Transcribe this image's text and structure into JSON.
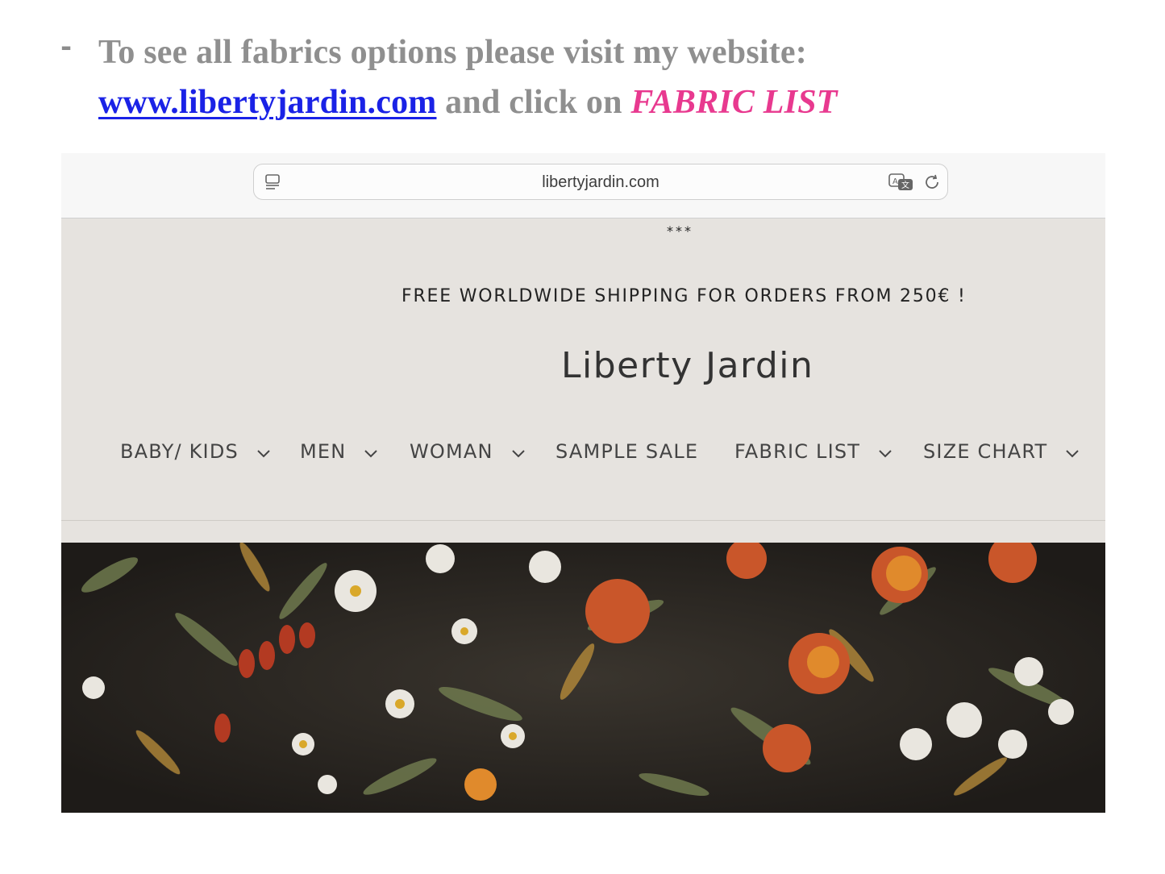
{
  "instruction": {
    "dash": "-",
    "line1": "To see all fabrics options please visit my website:",
    "link": "www.libertyjardin.com",
    "middle": " and click on ",
    "highlight": "FABRIC LIST"
  },
  "browser": {
    "url": "libertyjardin.com",
    "icons": [
      "reader-icon",
      "translate-icon",
      "reload-icon"
    ]
  },
  "site": {
    "stars": "***",
    "announcement": "FREE WORLDWIDE SHIPPING FOR ORDERS FROM 250€ !",
    "logo": "Liberty Jardin",
    "nav": [
      {
        "label": "BABY/ KIDS",
        "dropdown": true
      },
      {
        "label": "MEN",
        "dropdown": true
      },
      {
        "label": "WOMAN",
        "dropdown": true
      },
      {
        "label": "SAMPLE SALE",
        "dropdown": false
      },
      {
        "label": "FABRIC LIST",
        "dropdown": true
      },
      {
        "label": "SIZE CHART",
        "dropdown": true
      }
    ]
  },
  "colors": {
    "text_gray": "#8f8f8f",
    "link_blue": "#1a22e6",
    "highlight_pink": "#e8398f",
    "site_bg": "#e6e3df"
  }
}
